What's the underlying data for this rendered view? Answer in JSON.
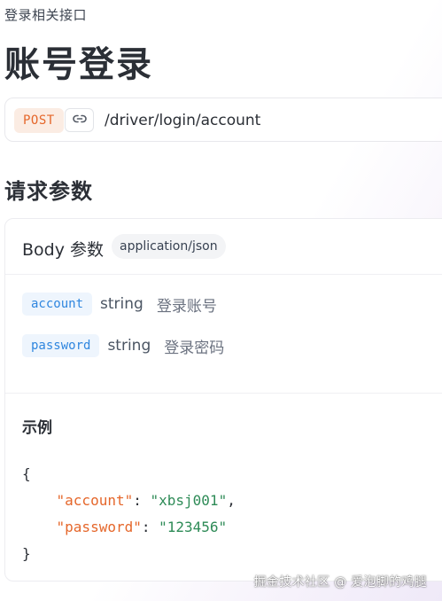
{
  "breadcrumb": "登录相关接口",
  "page_title": "账号登录",
  "endpoint": {
    "method": "POST",
    "link_icon": "link-icon",
    "path": "/driver/login/account"
  },
  "request_section": {
    "title": "请求参数"
  },
  "body": {
    "label": "Body 参数",
    "content_type": "application/json",
    "params": [
      {
        "name": "account",
        "type": "string",
        "description": "登录账号"
      },
      {
        "name": "password",
        "type": "string",
        "description": "登录密码"
      }
    ]
  },
  "example": {
    "label": "示例",
    "open_brace": "{",
    "close_brace": "}",
    "lines": [
      {
        "key": "\"account\"",
        "value": "\"xbsj001\"",
        "trailing": ","
      },
      {
        "key": "\"password\"",
        "value": "\"123456\"",
        "trailing": ""
      }
    ]
  },
  "watermark": "掘金技术社区 @ 爱泡脚的鸡腿",
  "colors": {
    "method": "#e5672b",
    "param_name": "#2f86df",
    "json_key": "#e5672b",
    "json_string": "#2e8b57"
  }
}
